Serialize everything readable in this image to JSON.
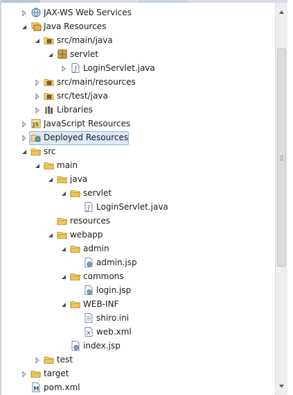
{
  "tree": [
    {
      "label": "JAX-WS Web Services",
      "icon": "web-services-icon",
      "twisty": "collapsed",
      "level": 1
    },
    {
      "label": "Java Resources",
      "icon": "java-resources-icon",
      "twisty": "expanded",
      "level": 1
    },
    {
      "label": "src/main/java",
      "icon": "source-folder-icon",
      "twisty": "expanded",
      "level": 2
    },
    {
      "label": "servlet",
      "icon": "package-icon",
      "twisty": "expanded",
      "level": 3
    },
    {
      "label": "LoginServlet.java",
      "icon": "java-file-icon",
      "twisty": "collapsed",
      "level": 4
    },
    {
      "label": "src/main/resources",
      "icon": "source-folder-icon",
      "twisty": "collapsed",
      "level": 2
    },
    {
      "label": "src/test/java",
      "icon": "source-folder-icon",
      "twisty": "collapsed",
      "level": 2
    },
    {
      "label": "Libraries",
      "icon": "libraries-icon",
      "twisty": "collapsed",
      "level": 2
    },
    {
      "label": "JavaScript Resources",
      "icon": "javascript-resources-icon",
      "twisty": "collapsed",
      "level": 1
    },
    {
      "label": "Deployed Resources",
      "icon": "deployed-resources-icon",
      "twisty": "collapsed",
      "level": 1,
      "selected": true
    },
    {
      "label": "src",
      "icon": "folder-icon",
      "twisty": "expanded",
      "level": 1
    },
    {
      "label": "main",
      "icon": "folder-icon",
      "twisty": "expanded",
      "level": 2
    },
    {
      "label": "java",
      "icon": "folder-icon",
      "twisty": "expanded",
      "level": 3
    },
    {
      "label": "servlet",
      "icon": "folder-icon",
      "twisty": "expanded",
      "level": 4
    },
    {
      "label": "LoginServlet.java",
      "icon": "java-file-icon",
      "twisty": "none",
      "level": 5
    },
    {
      "label": "resources",
      "icon": "folder-icon",
      "twisty": "none",
      "level": 3
    },
    {
      "label": "webapp",
      "icon": "folder-icon",
      "twisty": "expanded",
      "level": 3
    },
    {
      "label": "admin",
      "icon": "folder-icon",
      "twisty": "expanded",
      "level": 4
    },
    {
      "label": "admin.jsp",
      "icon": "jsp-file-icon",
      "twisty": "none",
      "level": 5
    },
    {
      "label": "commons",
      "icon": "folder-icon",
      "twisty": "expanded",
      "level": 4
    },
    {
      "label": "login.jsp",
      "icon": "jsp-file-icon",
      "twisty": "none",
      "level": 5
    },
    {
      "label": "WEB-INF",
      "icon": "folder-icon",
      "twisty": "expanded",
      "level": 4
    },
    {
      "label": "shiro.ini",
      "icon": "ini-file-icon",
      "twisty": "none",
      "level": 5
    },
    {
      "label": "web.xml",
      "icon": "xml-file-icon",
      "twisty": "none",
      "level": 5
    },
    {
      "label": "index.jsp",
      "icon": "jsp-file-icon",
      "twisty": "none",
      "level": 4
    },
    {
      "label": "test",
      "icon": "folder-icon",
      "twisty": "collapsed",
      "level": 2
    },
    {
      "label": "target",
      "icon": "folder-icon",
      "twisty": "collapsed",
      "level": 1
    },
    {
      "label": "pom.xml",
      "icon": "maven-pom-icon",
      "twisty": "none",
      "level": 1
    }
  ],
  "colors": {
    "selection_fill": "#dbe9f8",
    "selection_border": "#8fb4de",
    "folder": "#e8c25a",
    "package": "#b58a2e",
    "twisty": "#7a7a7a"
  }
}
